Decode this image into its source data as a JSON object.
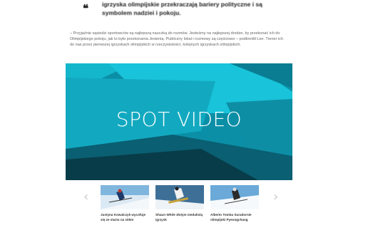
{
  "article": {
    "quote_mark": "❝",
    "headline": "igrzyska olimpijskie przekraczają bariery polityczne i są symbolem nadziei i pokoju.",
    "body": "– Przyjaźnie sąsiedzi sportowców są najlepszą nauczką do rozmów. Jesteśmy na najlepszej drodze, by przekonać ich do Olimpijskiego pokoju, jak to było przekonania Jesienią. Publiczny lokal i rozmowy są częściowo – podkreślił Lee. Trener ich do nas przez pierwszej igrzyskach olimpijskich w rzeczywistości, kolejnych igrzyskach olimpijskich."
  },
  "video": {
    "label": "SPOT VIDEO",
    "colors": {
      "base": "#0b8fa6",
      "light": "#19c3d9",
      "mid": "#12a9c0",
      "dark": "#0a5f72",
      "darkest": "#083c49"
    }
  },
  "carousel": {
    "prev_icon": "‹",
    "next_icon": "›",
    "items": [
      {
        "caption": "Justyna Kowalczyk wycofuje się ze startu na 10km"
      },
      {
        "caption": "Shaun White złotym medalistą igrzysk"
      },
      {
        "caption": "Alberto Tomba Suradornie olimpijski Pyeongchang"
      }
    ]
  }
}
